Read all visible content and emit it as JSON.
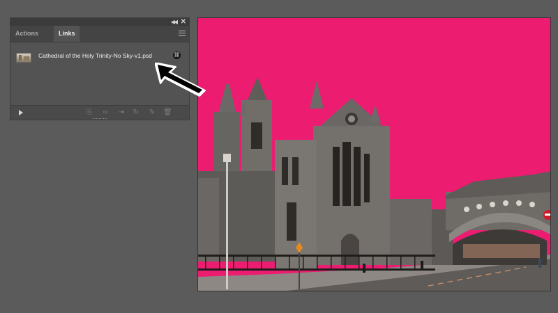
{
  "panel": {
    "tabs": [
      {
        "label": "Actions",
        "active": false
      },
      {
        "label": "Links",
        "active": true
      }
    ],
    "topbar": {
      "collapse_icon": "double-chevron-left",
      "close_icon": "close-x"
    },
    "links": [
      {
        "name": "Cathedral of the Holy Trinity-No Sky-v1.psd",
        "status_icon": "link-chain-icon"
      }
    ],
    "footer_icons": [
      "relink-from-cc-libraries-icon",
      "relink-icon",
      "go-to-link-icon",
      "update-link-icon",
      "edit-original-icon",
      "delete-icon"
    ]
  },
  "canvas": {
    "description_colors": {
      "background": "#ec1c70",
      "stone": "#6e6c6a",
      "road": "#5a5855"
    }
  },
  "colors": {
    "app_background": "#5b5b5b",
    "panel": "#535353",
    "tab_active_text": "#f0f0f0"
  }
}
